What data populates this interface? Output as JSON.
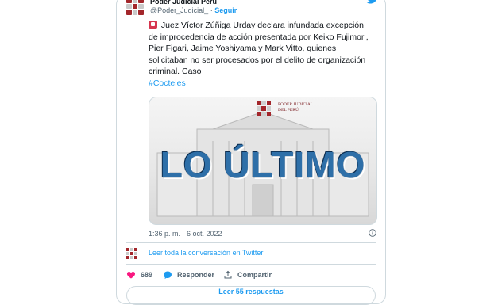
{
  "author": {
    "display_name": "Poder Judicial Perú",
    "handle": "@Poder_Judicial_",
    "separator": "·",
    "follow_label": "Seguir"
  },
  "tweet": {
    "text": "Juez Víctor Zúñiga Urday declara infundada excepción de improcedencia de acción presentada por Keiko Fujimori, Pier Figari, Jaime Yoshiyama y Mark Vitto, quienes solicitaban no ser procesados por el delito de organización criminal. Caso",
    "hashtag": "#Cocteles",
    "timestamp": "1:36 p. m. · 6 oct. 2022"
  },
  "media": {
    "headline": "LO ÚLTIMO",
    "logo_line1": "PODER JUDICIAL",
    "logo_line2": "DEL PERÚ"
  },
  "read_conversation": "Leer toda la conversación en Twitter",
  "actions": {
    "likes": "689",
    "reply_label": "Responder",
    "share_label": "Compartir"
  },
  "replies_button": "Leer 55 respuestas",
  "colors": {
    "accent": "#1d9bf0",
    "like": "#f91880",
    "brand": "#a3262b"
  },
  "icons": [
    "twitter-bird-icon",
    "flag-icon",
    "info-icon",
    "heart-icon",
    "reply-icon",
    "share-icon"
  ]
}
